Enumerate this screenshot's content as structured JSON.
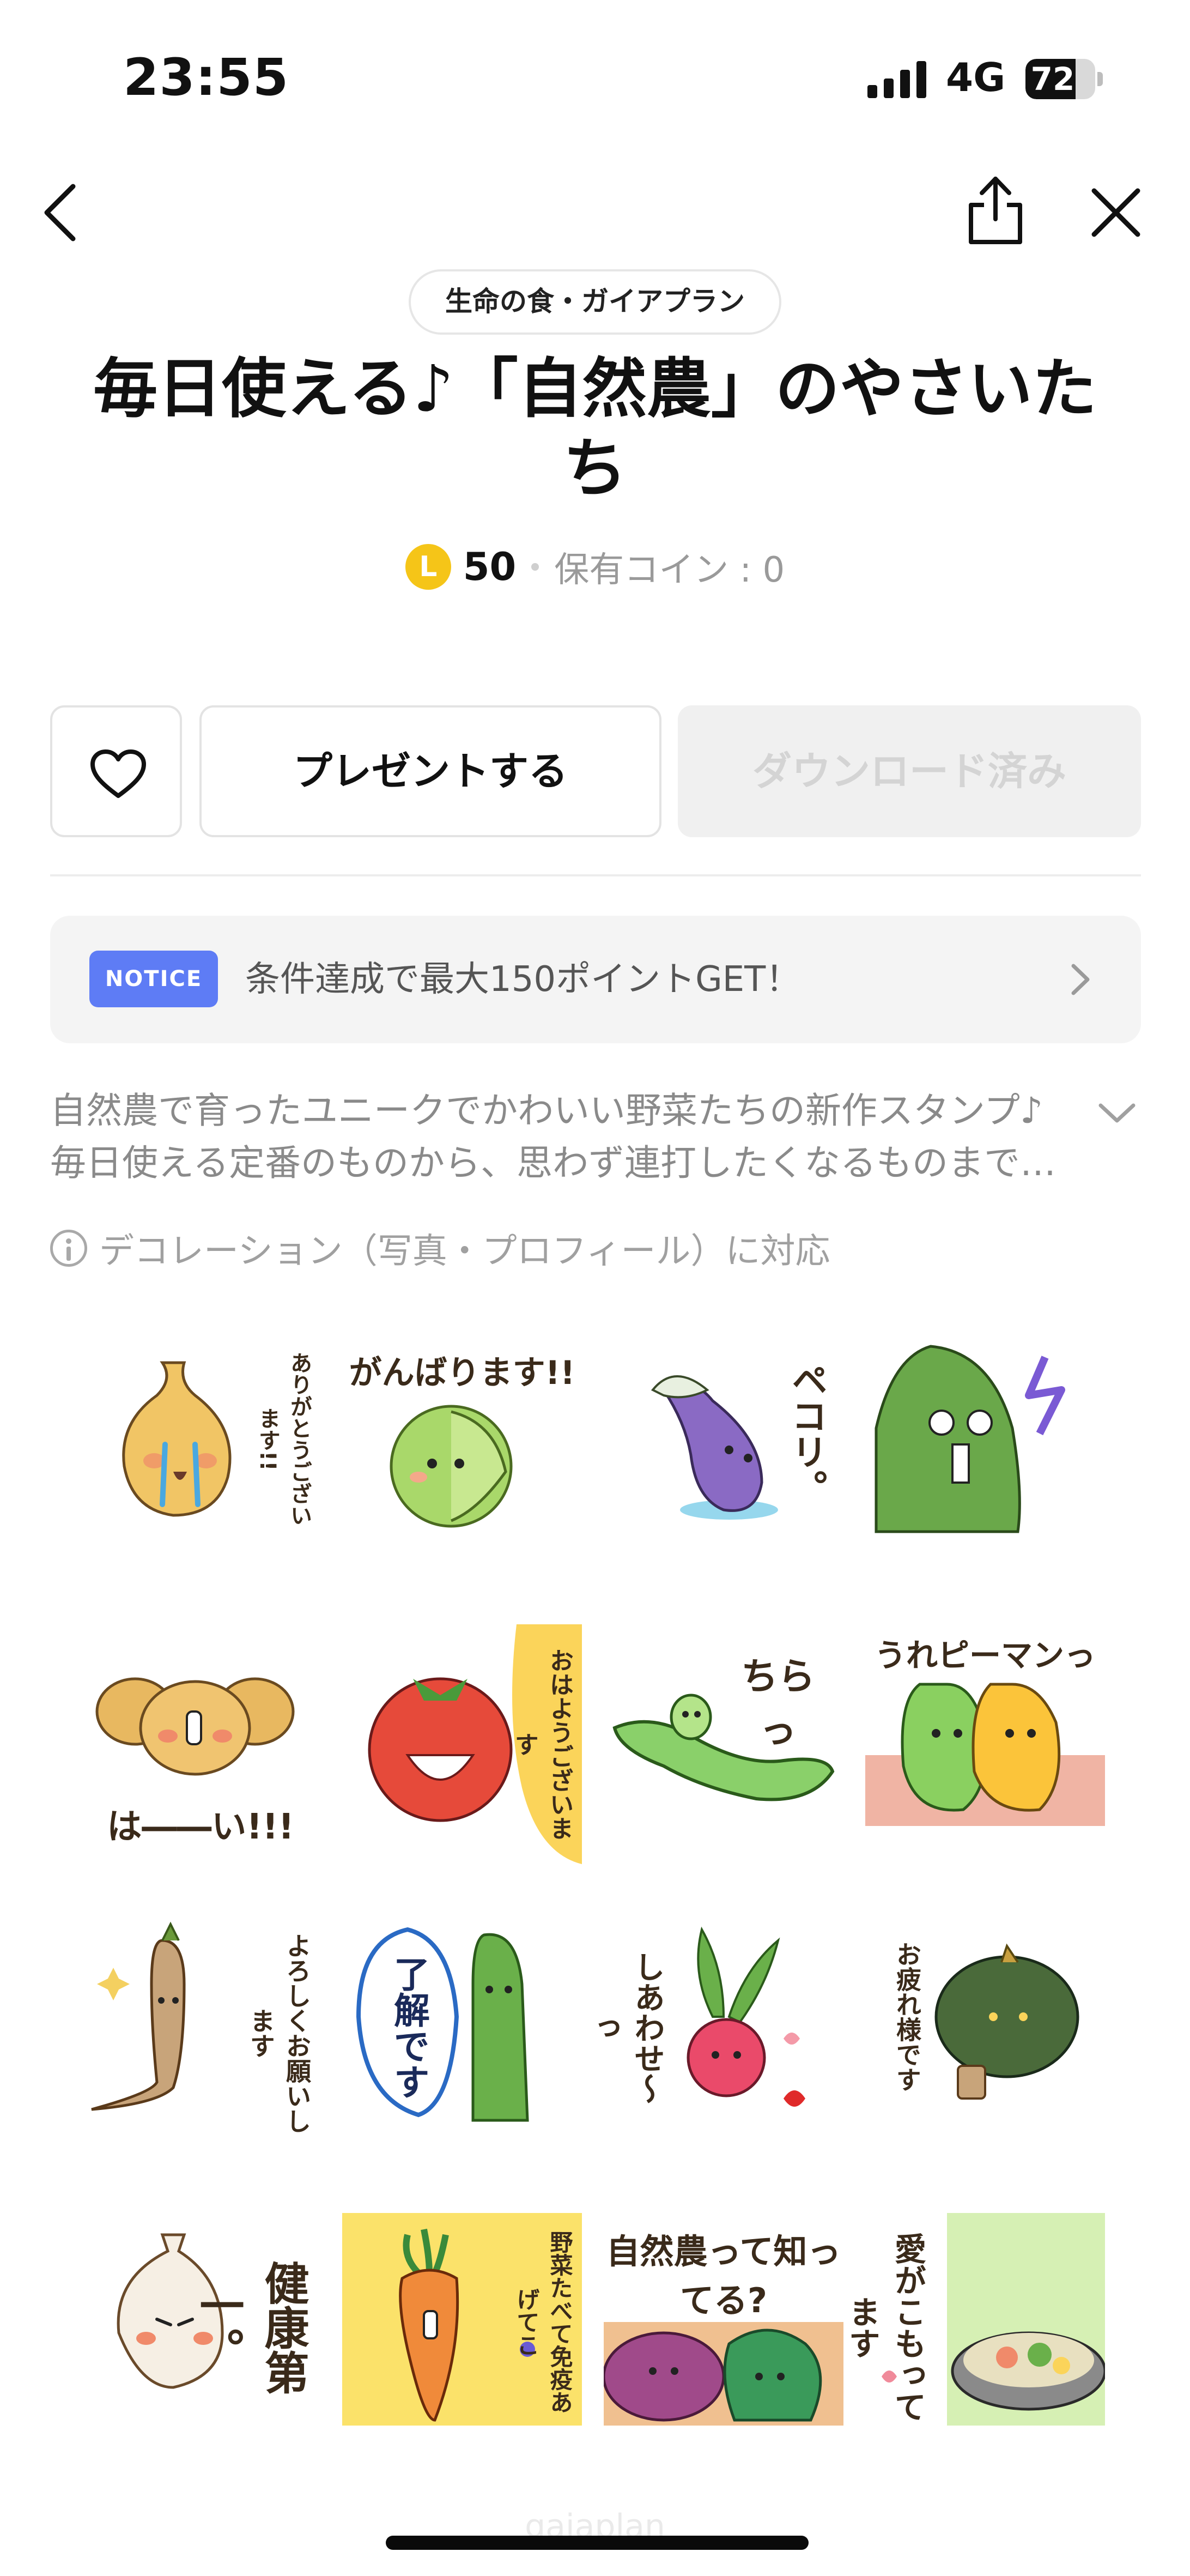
{
  "status_bar": {
    "time": "23:55",
    "network": "4G",
    "battery": "72",
    "battery_level": 0.72
  },
  "nav": {
    "back_icon": "chevron-left-icon",
    "share_icon": "share-icon",
    "close_icon": "close-icon"
  },
  "product": {
    "creator": "生命の食・ガイアプラン",
    "title": "毎日使える♪「自然農」のやさいたち",
    "coin_symbol": "L",
    "price": "50",
    "owned_coins": "保有コイン : 0"
  },
  "actions": {
    "favorite_icon": "heart-outline-icon",
    "gift_label": "プレゼントする",
    "download_label": "ダウンロード済み"
  },
  "notice": {
    "badge": "NOTICE",
    "text": "条件達成で最大150ポイントGET！"
  },
  "description": {
    "line1": "自然農で育ったユニークでかわいい野菜たちの新作スタンプ♪",
    "line2": "毎日使える定番のものから、思わず連打したくなるものまで…"
  },
  "decoration_support": "デコレーション（写真・プロフィール）に対応",
  "stickers": [
    {
      "text": "ありがとうございます!!",
      "vegetable": "onion"
    },
    {
      "text": "がんばります!!",
      "vegetable": "cabbage"
    },
    {
      "text": "ペコリ。",
      "vegetable": "eggplant"
    },
    {
      "text": "",
      "vegetable": "bitter-melon"
    },
    {
      "text": "は――い!!!",
      "vegetable": "potato"
    },
    {
      "text": "おはようございます",
      "vegetable": "tomato"
    },
    {
      "text": "ちらっ",
      "vegetable": "edamame"
    },
    {
      "text": "うれピーマンっ",
      "vegetable": "bell-pepper"
    },
    {
      "text": "よろしくお願いします",
      "vegetable": "burdock"
    },
    {
      "text": "了解です",
      "vegetable": "cucumber"
    },
    {
      "text": "しあわせ〜っ",
      "vegetable": "radish"
    },
    {
      "text": "お疲れ様です",
      "vegetable": "pumpkin"
    },
    {
      "text": "健康第一。",
      "vegetable": "garlic"
    },
    {
      "text": "野菜たべて免疫あげてこ",
      "vegetable": "carrot"
    },
    {
      "text": "自然農って知ってる?",
      "vegetable": "sweet-potato"
    },
    {
      "text": "愛がこもってます",
      "vegetable": "hot-pot"
    }
  ],
  "watermark": "gaiaplan",
  "colors": {
    "notice_badge": "#5e7cf5",
    "coin": "#f5c518",
    "download_disabled_bg": "#f0f0f0",
    "download_disabled_text": "#d4d4d4"
  }
}
